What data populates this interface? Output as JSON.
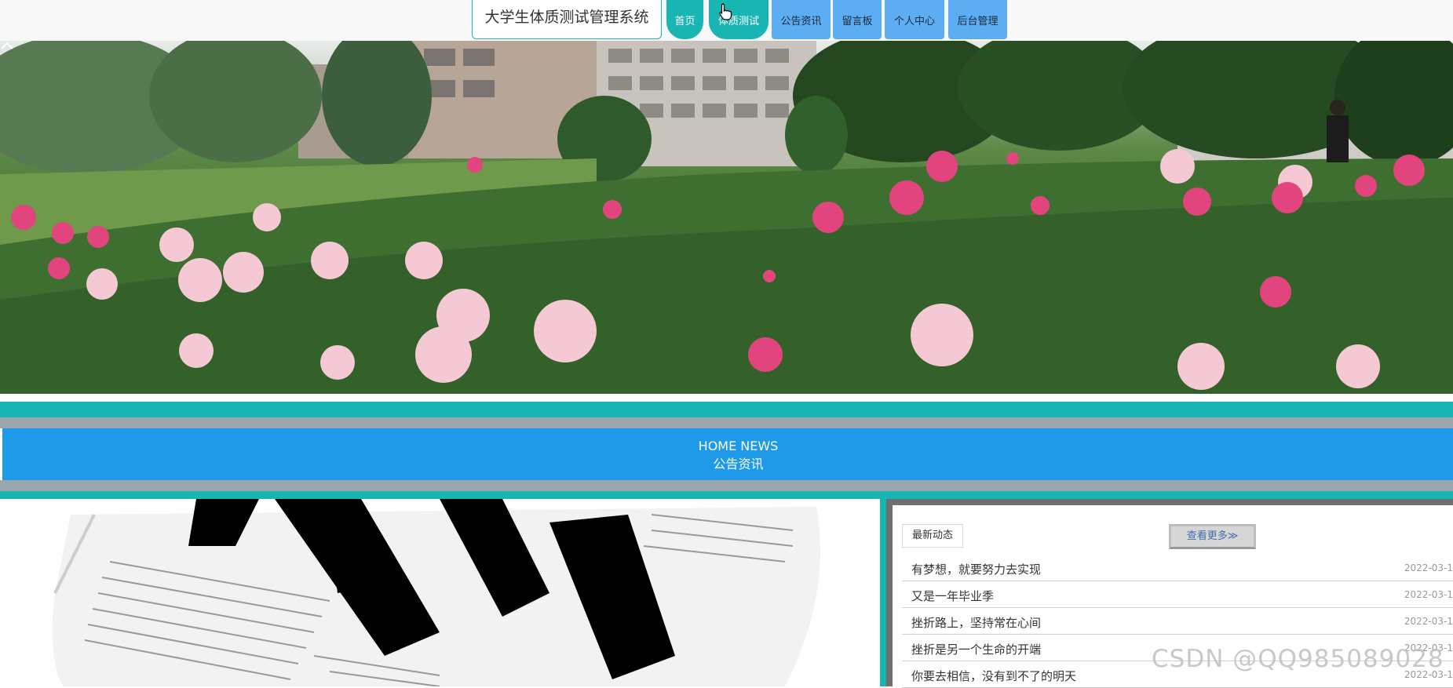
{
  "nav": {
    "brand": "大学生体质测试管理系统",
    "items": [
      {
        "label": "首页"
      },
      {
        "label": "体质测试"
      },
      {
        "label": "公告资讯"
      },
      {
        "label": "留言板"
      },
      {
        "label": "个人中心"
      },
      {
        "label": "后台管理"
      }
    ]
  },
  "section": {
    "title_en": "HOME NEWS",
    "title_cn": "公告资讯"
  },
  "news": {
    "tab_label": "最新动态",
    "more_label": "查看更多≫",
    "items": [
      {
        "title": "有梦想，就要努力去实现",
        "date": "2022-03-1"
      },
      {
        "title": "又是一年毕业季",
        "date": "2022-03-1"
      },
      {
        "title": "挫折路上，坚持常在心间",
        "date": "2022-03-1"
      },
      {
        "title": "挫折是另一个生命的开端",
        "date": "2022-03-1"
      },
      {
        "title": "你要去相信，没有到不了的明天",
        "date": "2022-03-1"
      }
    ]
  },
  "watermark": "CSDN @QQ985089028",
  "colors": {
    "teal": "#19b5b3",
    "blue": "#1e9ae8",
    "nav_blue": "#5cadf2",
    "grey": "#9aa6ae"
  }
}
